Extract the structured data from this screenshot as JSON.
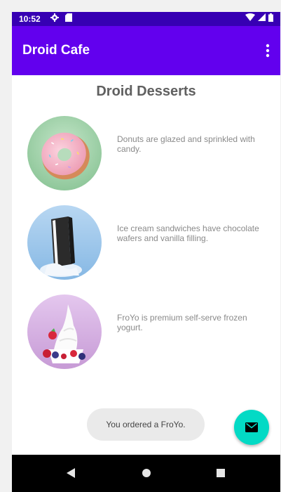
{
  "status_bar": {
    "time": "10:52",
    "color": "#3700b3",
    "left_icons": [
      "settings-icon",
      "sd-card-icon"
    ],
    "right_icons": [
      "wifi-icon",
      "signal-icon",
      "battery-icon"
    ]
  },
  "app_bar": {
    "title": "Droid Cafe",
    "color": "#6200ee",
    "menu_icon": "overflow-menu-icon"
  },
  "page": {
    "title": "Droid Desserts"
  },
  "desserts": [
    {
      "description": "Donuts are glazed and sprinkled with candy.",
      "image": "donut-image",
      "background": "#a9d8b0"
    },
    {
      "description": "Ice cream sandwiches have chocolate wafers and vanilla filling.",
      "image": "ice-cream-sandwich-image",
      "background": "#9ec7ea"
    },
    {
      "description": "FroYo is premium self-serve frozen yogurt.",
      "image": "froyo-image",
      "background": "#d9b8e3"
    }
  ],
  "toast": {
    "message": "You ordered a FroYo."
  },
  "fab": {
    "icon": "email-icon",
    "color": "#03dac5"
  },
  "nav_bar": {
    "buttons": [
      "back-icon",
      "home-icon",
      "recents-icon"
    ]
  }
}
